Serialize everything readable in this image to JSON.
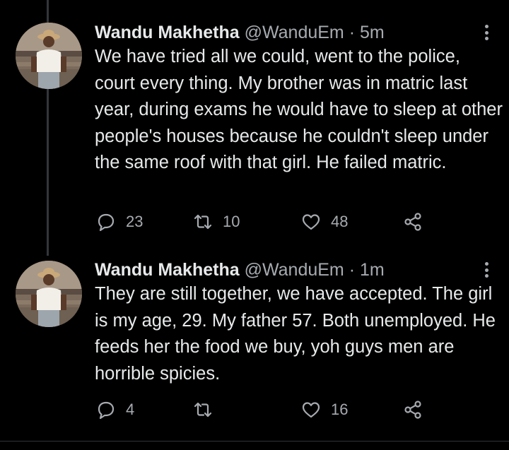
{
  "tweets": [
    {
      "author": {
        "display_name": "Wandu Makhetha",
        "handle": "@WanduEm"
      },
      "separator": "·",
      "time": "5m",
      "text": "We have tried all we could, went to the police, court every thing. My brother was in matric last year, during exams he would have to sleep at other people's houses because he couldn't sleep under the same roof with that girl. He failed matric.",
      "actions": {
        "replies": "23",
        "retweets": "10",
        "likes": "48"
      }
    },
    {
      "author": {
        "display_name": "Wandu Makhetha",
        "handle": "@WanduEm"
      },
      "separator": "·",
      "time": "1m",
      "text": "They are still together, we have accepted. The girl is my age, 29. My father 57. Both unemployed. He feeds her the food we buy, yoh guys men are horrible spicies.",
      "actions": {
        "replies": "4",
        "retweets": "",
        "likes": "16"
      }
    }
  ],
  "icons": {
    "reply": "reply-icon",
    "retweet": "retweet-icon",
    "like": "heart-icon",
    "share": "share-icon",
    "more": "more-vertical-icon"
  },
  "colors": {
    "background": "#000000",
    "primary_text": "#e7e9ea",
    "secondary_text": "#a7abb0",
    "thread_line": "#333639"
  }
}
